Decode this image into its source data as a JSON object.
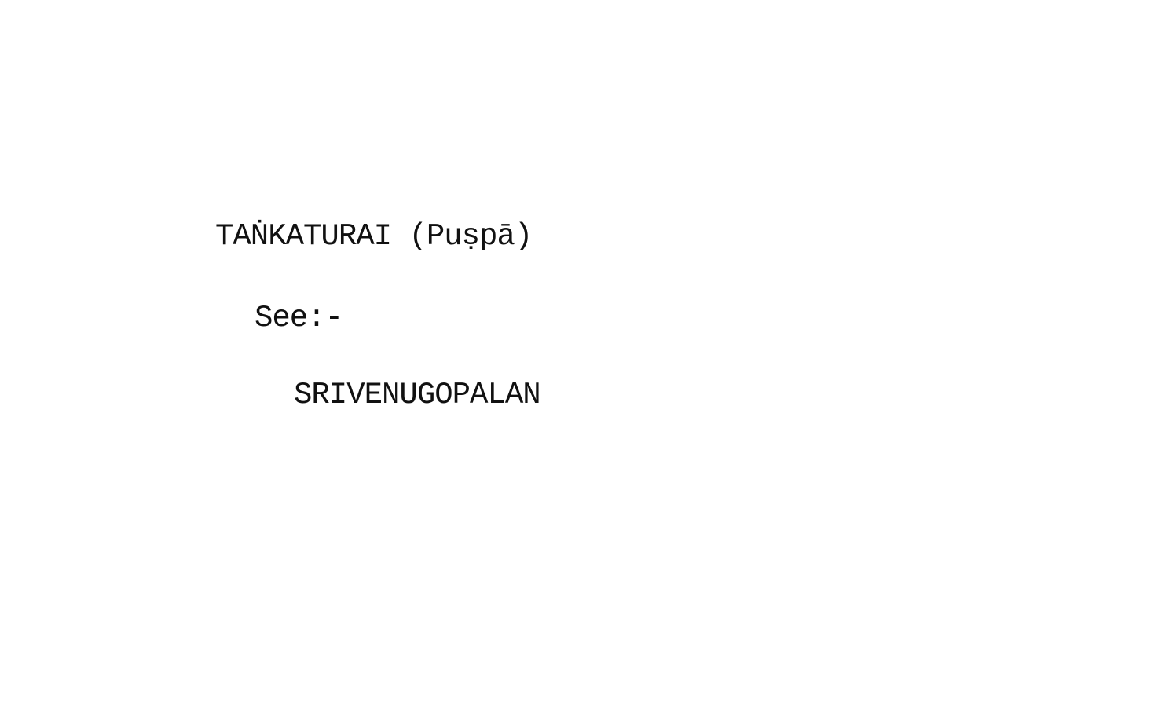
{
  "card": {
    "heading": "TAṄKATURAI (Puṣpā)",
    "see_label": "See:-",
    "reference": "SRIVENUGOPALAN"
  }
}
